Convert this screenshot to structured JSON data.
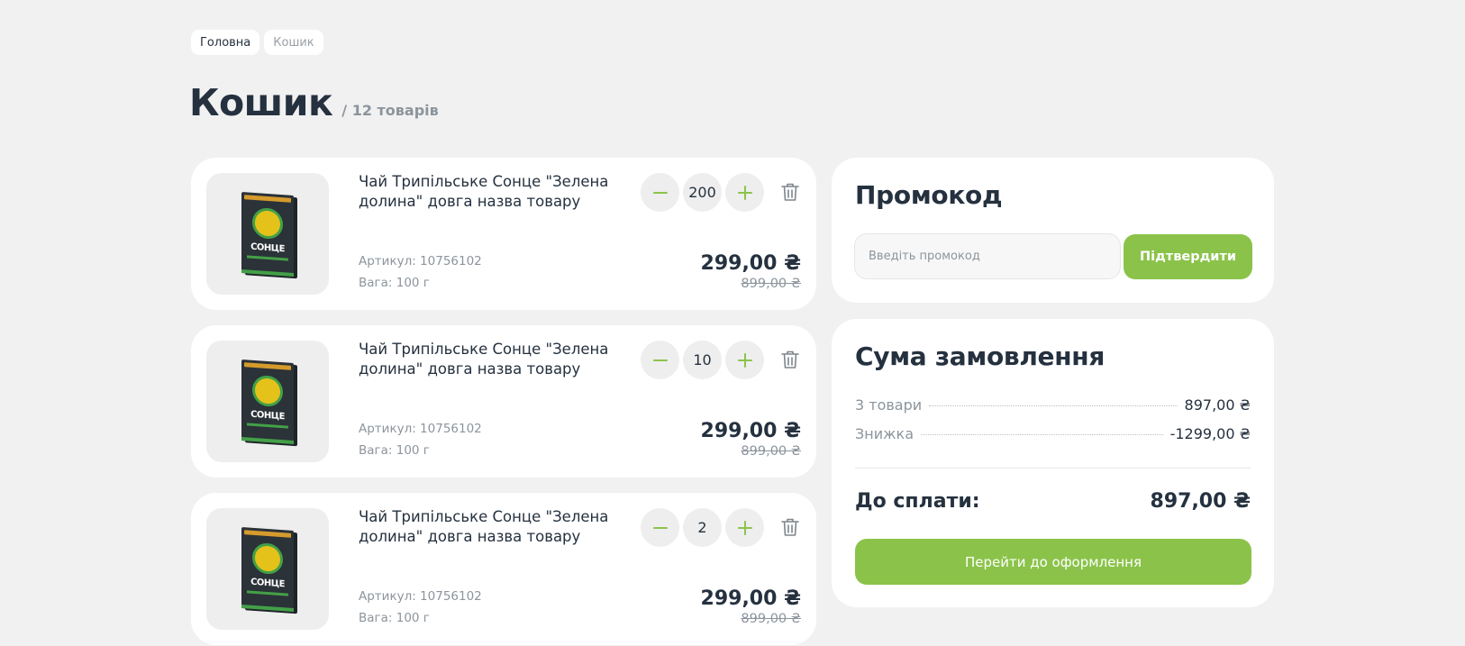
{
  "breadcrumb": {
    "home": "Головна",
    "current": "Кошик"
  },
  "page": {
    "title": "Кошик",
    "count": "/ 12 товарів"
  },
  "cart": {
    "items": [
      {
        "name": "Чай Трипільське Сонце \"Зелена долина\" довга назва товару",
        "article": "Артикул: 10756102",
        "weight": "Вага: 100 г",
        "quantity": "200",
        "price": "299,00 ₴",
        "old_price": "899,00 ₴"
      },
      {
        "name": "Чай Трипільське Сонце \"Зелена долина\" довга назва товару",
        "article": "Артикул: 10756102",
        "weight": "Вага: 100 г",
        "quantity": "10",
        "price": "299,00 ₴",
        "old_price": "899,00 ₴"
      },
      {
        "name": "Чай Трипільське Сонце \"Зелена долина\" довга назва товару",
        "article": "Артикул: 10756102",
        "weight": "Вага: 100 г",
        "quantity": "2",
        "price": "299,00 ₴",
        "old_price": "899,00 ₴"
      }
    ],
    "product_image_text": "СОНЦЕ"
  },
  "promo": {
    "title": "Промокод",
    "placeholder": "Введіть промокод",
    "button": "Підтвердити"
  },
  "summary": {
    "title": "Сума замовлення",
    "items_label": "3 товари",
    "items_value": "897,00 ₴",
    "discount_label": "Знижка",
    "discount_value": "-1299,00 ₴",
    "total_label": "До сплати:",
    "total_value": "897,00 ₴",
    "checkout_button": "Перейти до оформлення"
  },
  "colors": {
    "accent": "#8bc34a",
    "text": "#25313f",
    "muted": "#8c949c",
    "background": "#f1f1f1"
  },
  "icons": {
    "minus": "minus-icon",
    "plus": "plus-icon",
    "delete": "trash-icon"
  }
}
